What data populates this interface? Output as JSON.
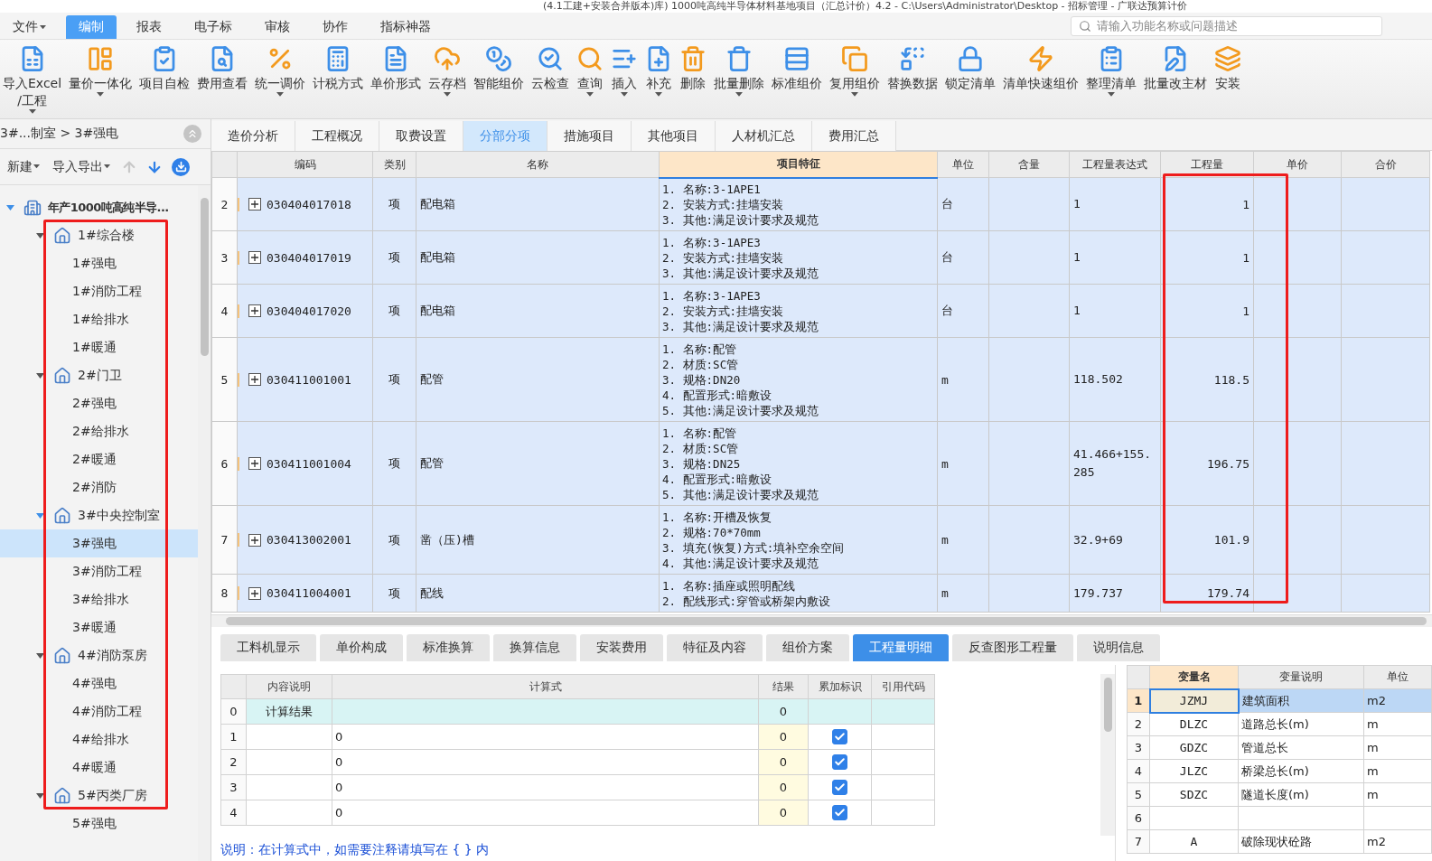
{
  "window": {
    "title": "(4.1工建+安装合并版本)库)  1000吨高纯半导体材料基地项目（汇总计价）4.2 - C:\\Users\\Administrator\\Desktop - 招标管理 - 广联达预算计价"
  },
  "menu": [
    {
      "label": "文件",
      "dropdown": true,
      "selected": false
    },
    {
      "label": "编制",
      "dropdown": false,
      "selected": true
    },
    {
      "label": "报表",
      "dropdown": false,
      "selected": false
    },
    {
      "label": "电子标",
      "dropdown": false,
      "selected": false
    },
    {
      "label": "审核",
      "dropdown": false,
      "selected": false
    },
    {
      "label": "协作",
      "dropdown": false,
      "selected": false
    },
    {
      "label": "指标神器",
      "dropdown": false,
      "selected": false
    }
  ],
  "search": {
    "placeholder": "请输入功能名称或问题描述"
  },
  "toolbar": [
    {
      "label": "导入Excel\n/工程",
      "dropdown": true
    },
    {
      "label": "量价一体化",
      "dropdown": true
    },
    {
      "label": "项目自检",
      "dropdown": false
    },
    {
      "label": "费用查看",
      "dropdown": false
    },
    {
      "label": "统一调价",
      "dropdown": true
    },
    {
      "label": "计税方式",
      "dropdown": false
    },
    {
      "label": "单价形式",
      "dropdown": false
    },
    {
      "label": "云存档",
      "dropdown": true
    },
    {
      "label": "智能组价",
      "dropdown": false
    },
    {
      "label": "云检查",
      "dropdown": false
    },
    {
      "label": "查询",
      "dropdown": true
    },
    {
      "label": "插入",
      "dropdown": true
    },
    {
      "label": "补充",
      "dropdown": true
    },
    {
      "label": "删除",
      "dropdown": false
    },
    {
      "label": "批量删除",
      "dropdown": true
    },
    {
      "label": "标准组价",
      "dropdown": false
    },
    {
      "label": "复用组价",
      "dropdown": true
    },
    {
      "label": "替换数据",
      "dropdown": false
    },
    {
      "label": "锁定清单",
      "dropdown": false
    },
    {
      "label": "清单快速组价",
      "dropdown": false
    },
    {
      "label": "整理清单",
      "dropdown": true
    },
    {
      "label": "批量改主材",
      "dropdown": false
    },
    {
      "label": "安装",
      "dropdown": false
    }
  ],
  "breadcrumb": "3#...制室 > 3#强电",
  "left_toolbar": [
    {
      "label": "新建",
      "kind": "menu",
      "disabled": false
    },
    {
      "label": "导入导出",
      "kind": "menu",
      "disabled": false
    },
    {
      "kind": "up",
      "disabled": true
    },
    {
      "kind": "down",
      "disabled": false
    },
    {
      "kind": "download",
      "disabled": false
    }
  ],
  "tree": [
    {
      "label": "年产1000吨高纯半导...",
      "expanded": true,
      "selected": false,
      "children": [
        {
          "label": "1#综合楼",
          "expanded": true,
          "selected": false,
          "children": [
            {
              "label": "1#强电",
              "selected": false
            },
            {
              "label": "1#消防工程",
              "selected": false
            },
            {
              "label": "1#给排水",
              "selected": false
            },
            {
              "label": "1#暖通",
              "selected": false
            }
          ]
        },
        {
          "label": "2#门卫",
          "expanded": true,
          "selected": false,
          "children": [
            {
              "label": "2#强电",
              "selected": false
            },
            {
              "label": "2#给排水",
              "selected": false
            },
            {
              "label": "2#暖通",
              "selected": false
            },
            {
              "label": "2#消防",
              "selected": false
            }
          ]
        },
        {
          "label": "3#中央控制室",
          "expanded": true,
          "selected": false,
          "children": [
            {
              "label": "3#强电",
              "selected": true
            },
            {
              "label": "3#消防工程",
              "selected": false
            },
            {
              "label": "3#给排水",
              "selected": false
            },
            {
              "label": "3#暖通",
              "selected": false
            }
          ]
        },
        {
          "label": "4#消防泵房",
          "expanded": true,
          "selected": false,
          "children": [
            {
              "label": "4#强电",
              "selected": false
            },
            {
              "label": "4#消防工程",
              "selected": false
            },
            {
              "label": "4#给排水",
              "selected": false
            },
            {
              "label": "4#暖通",
              "selected": false
            }
          ]
        },
        {
          "label": "5#丙类厂房",
          "expanded": true,
          "selected": false,
          "children": [
            {
              "label": "5#强电",
              "selected": false
            }
          ]
        }
      ]
    }
  ],
  "tabs": [
    {
      "label": "造价分析",
      "selected": false
    },
    {
      "label": "工程概况",
      "selected": false
    },
    {
      "label": "取费设置",
      "selected": false
    },
    {
      "label": "分部分项",
      "selected": true
    },
    {
      "label": "措施项目",
      "selected": false
    },
    {
      "label": "其他项目",
      "selected": false
    },
    {
      "label": "人材机汇总",
      "selected": false
    },
    {
      "label": "费用汇总",
      "selected": false
    }
  ],
  "table": {
    "columns": [
      "编码",
      "类别",
      "名称",
      "项目特征",
      "单位",
      "含量",
      "工程量表达式",
      "工程量",
      "单价",
      "合价"
    ],
    "rows": [
      {
        "no": "2",
        "code": "030404017018",
        "type": "项",
        "name": "配电箱",
        "features": [
          "1. 名称:3-1APE1",
          "2. 安装方式:挂墙安装",
          "3. 其他:满足设计要求及规范"
        ],
        "unit": "台",
        "expression": "1",
        "quantity": "1"
      },
      {
        "no": "3",
        "code": "030404017019",
        "type": "项",
        "name": "配电箱",
        "features": [
          "1. 名称:3-1APE3",
          "2. 安装方式:挂墙安装",
          "3. 其他:满足设计要求及规范"
        ],
        "unit": "台",
        "expression": "1",
        "quantity": "1"
      },
      {
        "no": "4",
        "code": "030404017020",
        "type": "项",
        "name": "配电箱",
        "features": [
          "1. 名称:3-1APE3",
          "2. 安装方式:挂墙安装",
          "3. 其他:满足设计要求及规范"
        ],
        "unit": "台",
        "expression": "1",
        "quantity": "1"
      },
      {
        "no": "5",
        "code": "030411001001",
        "type": "项",
        "name": "配管",
        "features": [
          "1. 名称:配管",
          "2. 材质:SC管",
          "3. 规格:DN20",
          "4. 配置形式:暗敷设",
          "5. 其他:满足设计要求及规范"
        ],
        "unit": "m",
        "expression": "118.502",
        "quantity": "118.5"
      },
      {
        "no": "6",
        "code": "030411001004",
        "type": "项",
        "name": "配管",
        "features": [
          "1. 名称:配管",
          "2. 材质:SC管",
          "3. 规格:DN25",
          "4. 配置形式:暗敷设",
          "5. 其他:满足设计要求及规范"
        ],
        "unit": "m",
        "expression": "41.466+155.285",
        "quantity": "196.75"
      },
      {
        "no": "7",
        "code": "030413002001",
        "type": "项",
        "name": "凿（压)槽",
        "features": [
          "1. 名称:开槽及恢复",
          "2. 规格:70*70mm",
          "3. 填充(恢复)方式:填补空余空间",
          "4. 其他:满足设计要求及规范"
        ],
        "unit": "m",
        "expression": "32.9+69",
        "quantity": "101.9"
      },
      {
        "no": "8",
        "code": "030411004001",
        "type": "项",
        "name": "配线",
        "features": [
          "1. 名称:插座或照明配线",
          "2. 配线形式:穿管或桥架内敷设"
        ],
        "unit": "m",
        "expression": "179.737",
        "quantity": "179.74"
      }
    ]
  },
  "bottom_tabs": [
    {
      "label": "工料机显示",
      "selected": false
    },
    {
      "label": "单价构成",
      "selected": false
    },
    {
      "label": "标准换算",
      "selected": false
    },
    {
      "label": "换算信息",
      "selected": false
    },
    {
      "label": "安装费用",
      "selected": false
    },
    {
      "label": "特征及内容",
      "selected": false
    },
    {
      "label": "组价方案",
      "selected": false
    },
    {
      "label": "工程量明细",
      "selected": true
    },
    {
      "label": "反查图形工程量",
      "selected": false
    },
    {
      "label": "说明信息",
      "selected": false
    }
  ],
  "calc_table": {
    "columns": [
      "内容说明",
      "计算式",
      "结果",
      "累加标识",
      "引用代码"
    ],
    "rows": [
      {
        "no": "0",
        "kind": "summary",
        "description": "计算结果",
        "result": "0"
      },
      {
        "no": "1",
        "kind": "line",
        "formula": "0",
        "result": "0",
        "checked": true
      },
      {
        "no": "2",
        "kind": "line",
        "formula": "0",
        "result": "0",
        "checked": true
      },
      {
        "no": "3",
        "kind": "line",
        "formula": "0",
        "result": "0",
        "checked": true
      },
      {
        "no": "4",
        "kind": "line",
        "formula": "0",
        "result": "0",
        "checked": true
      }
    ]
  },
  "variables": {
    "columns": [
      "变量名",
      "变量说明",
      "单位"
    ],
    "rows": [
      {
        "no": "1",
        "name": "JZMJ",
        "description": "建筑面积",
        "unit": "m2",
        "selected": true
      },
      {
        "no": "2",
        "name": "DLZC",
        "description": "道路总长(m)",
        "unit": "m",
        "selected": false
      },
      {
        "no": "3",
        "name": "GDZC",
        "description": "管道总长",
        "unit": "m",
        "selected": false
      },
      {
        "no": "4",
        "name": "JLZC",
        "description": "桥梁总长(m)",
        "unit": "m",
        "selected": false
      },
      {
        "no": "5",
        "name": "SDZC",
        "description": "隧道长度(m)",
        "unit": "m",
        "selected": false
      },
      {
        "no": "6",
        "selected": false
      },
      {
        "no": "7",
        "name": "A",
        "description": "破除现状砼路",
        "unit": "m2",
        "selected": false
      }
    ]
  },
  "note": "说明：在计算式中，如需要注释请填写在 { } 内"
}
